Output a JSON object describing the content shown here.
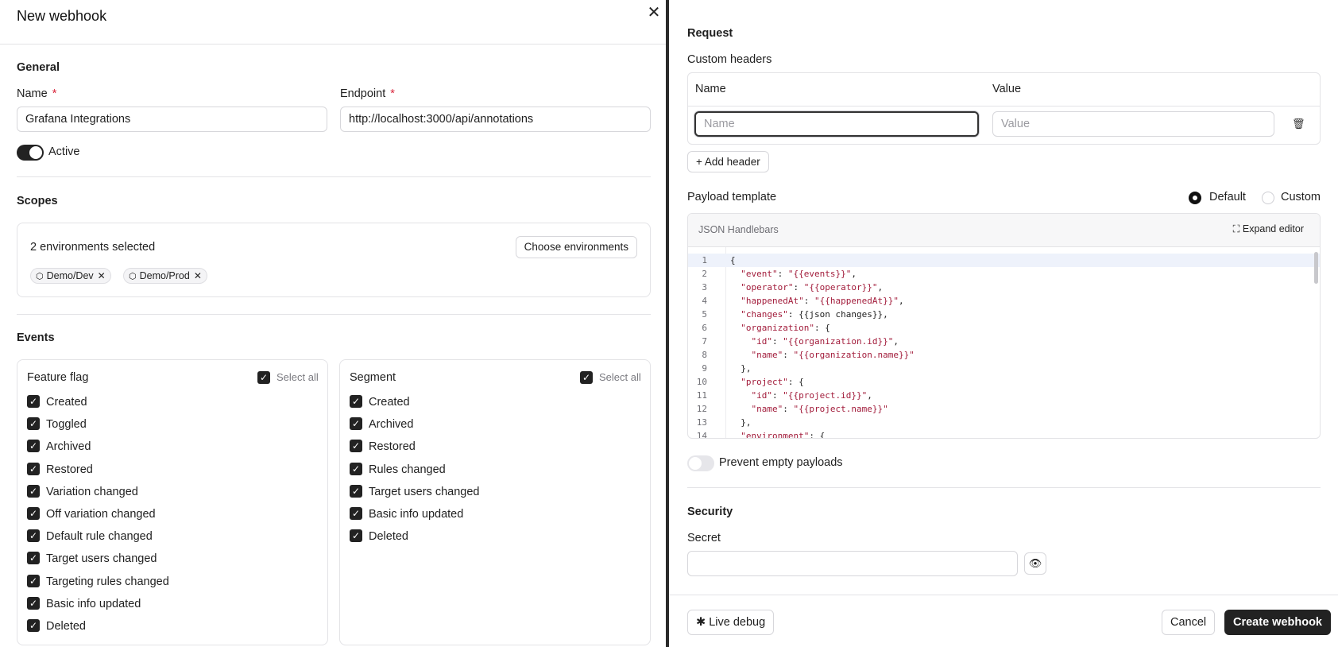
{
  "dialog": {
    "title": "New webhook"
  },
  "general": {
    "heading": "General",
    "name_label": "Name",
    "name_required": "*",
    "name_value": "Grafana Integrations",
    "endpoint_label": "Endpoint",
    "endpoint_required": "*",
    "endpoint_value": "http://localhost:3000/api/annotations",
    "active_label": "Active",
    "active": true
  },
  "scopes": {
    "heading": "Scopes",
    "summary": "2 environments selected",
    "choose_button": "Choose environments",
    "environments": [
      "Demo/Dev",
      "Demo/Prod"
    ]
  },
  "events": {
    "heading": "Events",
    "select_all_label": "Select all",
    "feature_flag": {
      "title": "Feature flag",
      "items": [
        "Created",
        "Toggled",
        "Archived",
        "Restored",
        "Variation changed",
        "Off variation changed",
        "Default rule changed",
        "Target users changed",
        "Targeting rules changed",
        "Basic info updated",
        "Deleted"
      ]
    },
    "segment": {
      "title": "Segment",
      "items": [
        "Created",
        "Archived",
        "Restored",
        "Rules changed",
        "Target users changed",
        "Basic info updated",
        "Deleted"
      ]
    }
  },
  "request": {
    "heading": "Request",
    "custom_headers_label": "Custom headers",
    "col_name": "Name",
    "col_value": "Value",
    "name_placeholder": "Name",
    "value_placeholder": "Value",
    "add_header": "Add header"
  },
  "payload": {
    "label": "Payload template",
    "option_default": "Default",
    "option_custom": "Custom",
    "selected": "Default",
    "editor_lang": "JSON Handlebars",
    "expand_editor": "Expand editor",
    "line_numbers": [
      "1",
      "2",
      "3",
      "4",
      "5",
      "6",
      "7",
      "8",
      "9",
      "10",
      "11",
      "12",
      "13",
      "14"
    ],
    "prevent_empty_label": "Prevent empty payloads",
    "prevent_empty": false
  },
  "security": {
    "heading": "Security",
    "secret_label": "Secret",
    "secret_value": ""
  },
  "footer": {
    "live_debug": "Live debug",
    "cancel": "Cancel",
    "create": "Create webhook"
  }
}
